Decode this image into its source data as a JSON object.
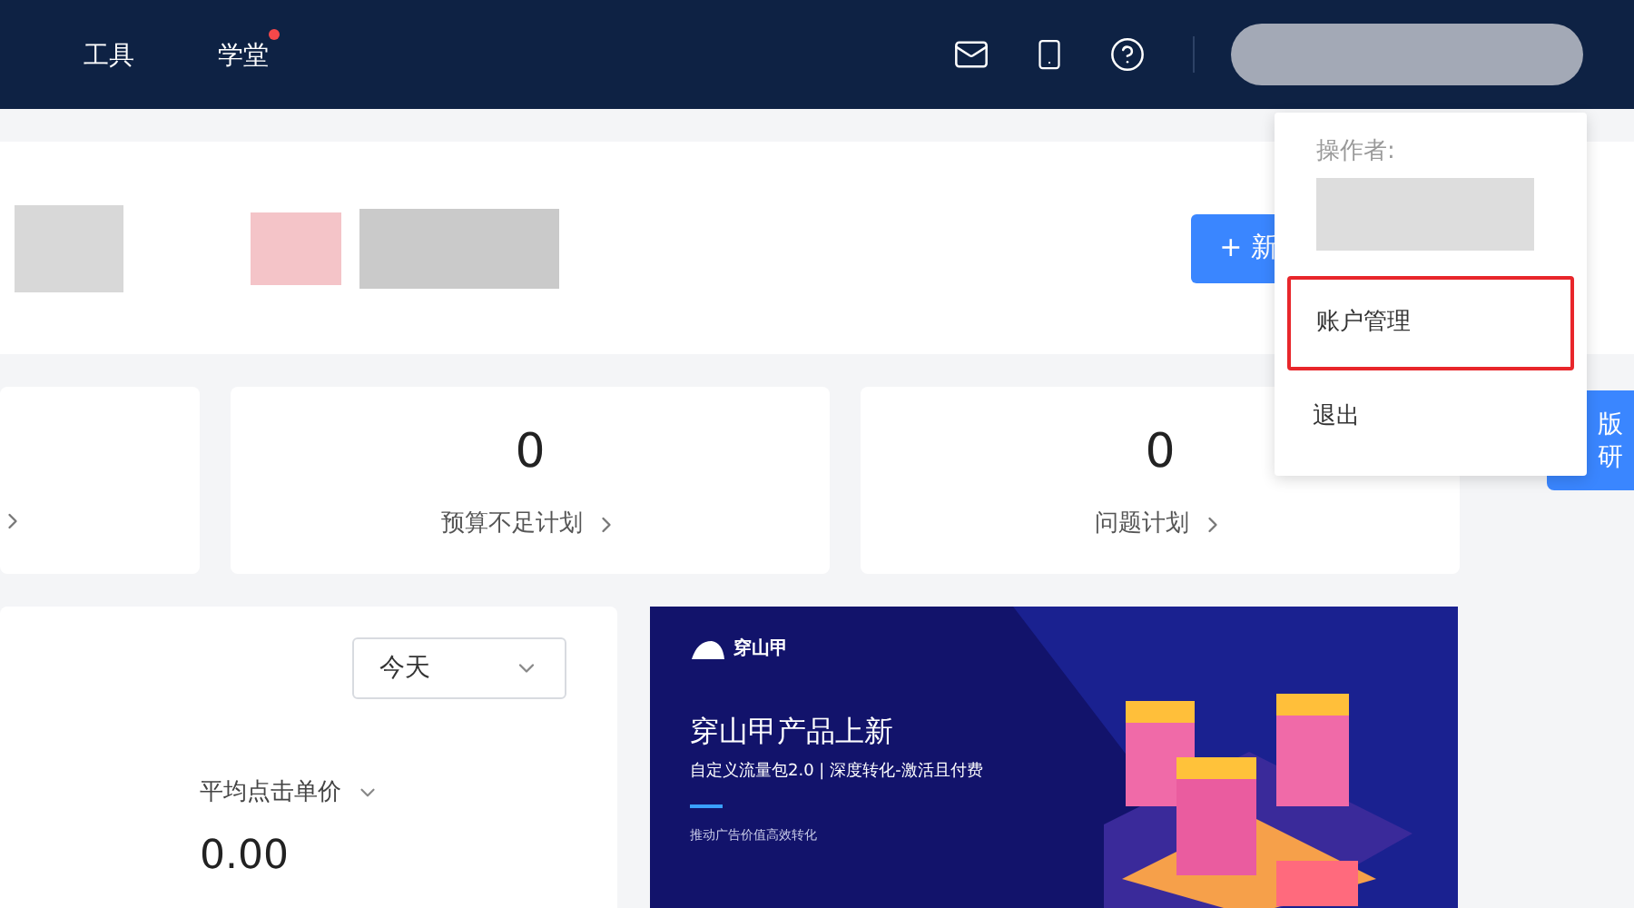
{
  "nav": [
    {
      "label": "工具",
      "badge": false
    },
    {
      "label": "学堂",
      "badge": true
    }
  ],
  "top_card": {
    "button": "+ 新"
  },
  "stats": [
    {
      "value": "0",
      "label": "预算不足计划"
    },
    {
      "value": "0",
      "label": "问题计划"
    }
  ],
  "report": {
    "range_select": "今天",
    "metric": "平均点击单价",
    "metric_value": "0.00"
  },
  "banner": {
    "logo": "穿山甲",
    "title": "穿山甲产品上新",
    "subtitle": "自定义流量包2.0 | 深度转化-激活且付费",
    "note": "推动广告价值高效转化"
  },
  "user_menu": {
    "operator_label": "操作者:",
    "items": [
      {
        "label": "账户管理",
        "highlighted": true
      },
      {
        "label": "退出",
        "highlighted": false
      }
    ]
  },
  "side_tab": [
    "版",
    "研"
  ]
}
